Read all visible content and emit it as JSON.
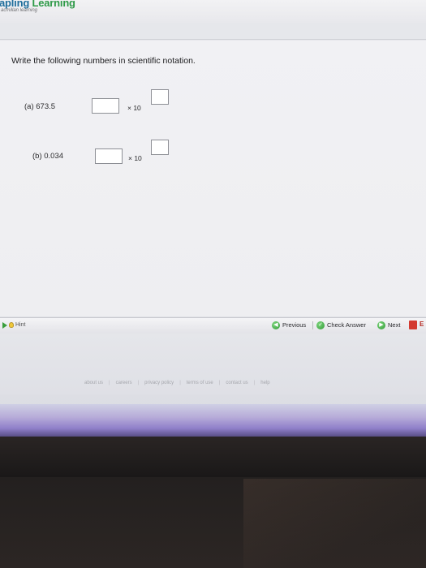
{
  "brand": {
    "name_part1": "apling",
    "name_part2": "Learning",
    "tagline": "acmillan learning"
  },
  "question": {
    "prompt": "Write the following numbers in scientific notation.",
    "parts": [
      {
        "label": "(a)  673.5",
        "times": "× 10",
        "coefficient_value": "",
        "exponent_value": ""
      },
      {
        "label": "(b)  0.034",
        "times": "× 10",
        "coefficient_value": "",
        "exponent_value": ""
      }
    ]
  },
  "nav": {
    "hint_label": "Hint",
    "previous_label": "Previous",
    "check_label": "Check Answer",
    "next_label": "Next",
    "exit_label": "E"
  },
  "footer": {
    "links": [
      "about us",
      "careers",
      "privacy policy",
      "terms of use",
      "contact us",
      "help"
    ]
  },
  "colors": {
    "brand_blue": "#1f6e9c",
    "brand_green": "#2e9a48",
    "nav_green": "#2f9a35",
    "exit_red": "#d33a31"
  }
}
